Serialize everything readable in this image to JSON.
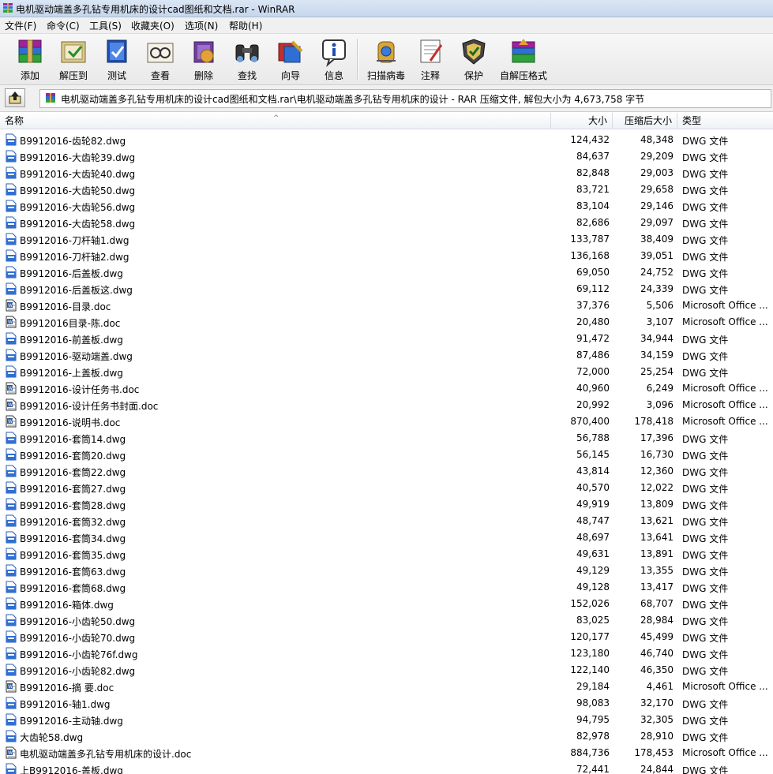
{
  "window": {
    "title": "电机驱动端盖多孔钻专用机床的设计cad图纸和文档.rar - WinRAR",
    "app_icon": "winrar-icon"
  },
  "menu": [
    {
      "label": "文件(F)"
    },
    {
      "label": "命令(C)"
    },
    {
      "label": "工具(S)"
    },
    {
      "label": "收藏夹(O)"
    },
    {
      "label": "选项(N)"
    },
    {
      "label": "帮助(H)"
    }
  ],
  "toolbar": [
    {
      "label": "添加",
      "icon": "add-archive-icon"
    },
    {
      "label": "解压到",
      "icon": "extract-to-icon"
    },
    {
      "label": "测试",
      "icon": "test-icon"
    },
    {
      "label": "查看",
      "icon": "view-icon"
    },
    {
      "label": "删除",
      "icon": "delete-icon"
    },
    {
      "label": "查找",
      "icon": "find-icon"
    },
    {
      "label": "向导",
      "icon": "wizard-icon"
    },
    {
      "label": "信息",
      "icon": "info-icon"
    },
    {
      "label": "扫描病毒",
      "icon": "virus-scan-icon"
    },
    {
      "label": "注释",
      "icon": "comment-icon"
    },
    {
      "label": "保护",
      "icon": "protect-icon"
    },
    {
      "label": "自解压格式",
      "icon": "sfx-icon"
    }
  ],
  "address": {
    "path": "电机驱动端盖多孔钻专用机床的设计cad图纸和文档.rar\\电机驱动端盖多孔钻专用机床的设计 - RAR 压缩文件, 解包大小为 4,673,758 字节"
  },
  "columns": {
    "name": "名称",
    "size": "大小",
    "packed": "压缩后大小",
    "type": "类型"
  },
  "files": [
    {
      "name": "B9912016-齿轮82.dwg",
      "size": "124,432",
      "packed": "48,348",
      "type": "DWG 文件",
      "icon": "dwg-file-icon"
    },
    {
      "name": "B9912016-大齿轮39.dwg",
      "size": "84,637",
      "packed": "29,209",
      "type": "DWG 文件",
      "icon": "dwg-file-icon"
    },
    {
      "name": "B9912016-大齿轮40.dwg",
      "size": "82,848",
      "packed": "29,003",
      "type": "DWG 文件",
      "icon": "dwg-file-icon"
    },
    {
      "name": "B9912016-大齿轮50.dwg",
      "size": "83,721",
      "packed": "29,658",
      "type": "DWG 文件",
      "icon": "dwg-file-icon"
    },
    {
      "name": "B9912016-大齿轮56.dwg",
      "size": "83,104",
      "packed": "29,146",
      "type": "DWG 文件",
      "icon": "dwg-file-icon"
    },
    {
      "name": "B9912016-大齿轮58.dwg",
      "size": "82,686",
      "packed": "29,097",
      "type": "DWG 文件",
      "icon": "dwg-file-icon"
    },
    {
      "name": "B9912016-刀杆轴1.dwg",
      "size": "133,787",
      "packed": "38,409",
      "type": "DWG 文件",
      "icon": "dwg-file-icon"
    },
    {
      "name": "B9912016-刀杆轴2.dwg",
      "size": "136,168",
      "packed": "39,051",
      "type": "DWG 文件",
      "icon": "dwg-file-icon"
    },
    {
      "name": "B9912016-后盖板.dwg",
      "size": "69,050",
      "packed": "24,752",
      "type": "DWG 文件",
      "icon": "dwg-file-icon"
    },
    {
      "name": "B9912016-后盖板这.dwg",
      "size": "69,112",
      "packed": "24,339",
      "type": "DWG 文件",
      "icon": "dwg-file-icon"
    },
    {
      "name": "B9912016-目录.doc",
      "size": "37,376",
      "packed": "5,506",
      "type": "Microsoft Office ...",
      "icon": "word-doc-icon"
    },
    {
      "name": "B9912016目录-陈.doc",
      "size": "20,480",
      "packed": "3,107",
      "type": "Microsoft Office ...",
      "icon": "word-doc-icon"
    },
    {
      "name": "B9912016-前盖板.dwg",
      "size": "91,472",
      "packed": "34,944",
      "type": "DWG 文件",
      "icon": "dwg-file-icon"
    },
    {
      "name": "B9912016-驱动端盖.dwg",
      "size": "87,486",
      "packed": "34,159",
      "type": "DWG 文件",
      "icon": "dwg-file-icon"
    },
    {
      "name": "B9912016-上盖板.dwg",
      "size": "72,000",
      "packed": "25,254",
      "type": "DWG 文件",
      "icon": "dwg-file-icon"
    },
    {
      "name": "B9912016-设计任务书.doc",
      "size": "40,960",
      "packed": "6,249",
      "type": "Microsoft Office ...",
      "icon": "word-doc-icon"
    },
    {
      "name": "B9912016-设计任务书封面.doc",
      "size": "20,992",
      "packed": "3,096",
      "type": "Microsoft Office ...",
      "icon": "word-doc-icon"
    },
    {
      "name": "B9912016-说明书.doc",
      "size": "870,400",
      "packed": "178,418",
      "type": "Microsoft Office ...",
      "icon": "word-doc-icon"
    },
    {
      "name": "B9912016-套筒14.dwg",
      "size": "56,788",
      "packed": "17,396",
      "type": "DWG 文件",
      "icon": "dwg-file-icon"
    },
    {
      "name": "B9912016-套筒20.dwg",
      "size": "56,145",
      "packed": "16,730",
      "type": "DWG 文件",
      "icon": "dwg-file-icon"
    },
    {
      "name": "B9912016-套筒22.dwg",
      "size": "43,814",
      "packed": "12,360",
      "type": "DWG 文件",
      "icon": "dwg-file-icon"
    },
    {
      "name": "B9912016-套筒27.dwg",
      "size": "40,570",
      "packed": "12,022",
      "type": "DWG 文件",
      "icon": "dwg-file-icon"
    },
    {
      "name": "B9912016-套筒28.dwg",
      "size": "49,919",
      "packed": "13,809",
      "type": "DWG 文件",
      "icon": "dwg-file-icon"
    },
    {
      "name": "B9912016-套筒32.dwg",
      "size": "48,747",
      "packed": "13,621",
      "type": "DWG 文件",
      "icon": "dwg-file-icon"
    },
    {
      "name": "B9912016-套筒34.dwg",
      "size": "48,697",
      "packed": "13,641",
      "type": "DWG 文件",
      "icon": "dwg-file-icon"
    },
    {
      "name": "B9912016-套筒35.dwg",
      "size": "49,631",
      "packed": "13,891",
      "type": "DWG 文件",
      "icon": "dwg-file-icon"
    },
    {
      "name": "B9912016-套筒63.dwg",
      "size": "49,129",
      "packed": "13,355",
      "type": "DWG 文件",
      "icon": "dwg-file-icon"
    },
    {
      "name": "B9912016-套筒68.dwg",
      "size": "49,128",
      "packed": "13,417",
      "type": "DWG 文件",
      "icon": "dwg-file-icon"
    },
    {
      "name": "B9912016-箱体.dwg",
      "size": "152,026",
      "packed": "68,707",
      "type": "DWG 文件",
      "icon": "dwg-file-icon"
    },
    {
      "name": "B9912016-小齿轮50.dwg",
      "size": "83,025",
      "packed": "28,984",
      "type": "DWG 文件",
      "icon": "dwg-file-icon"
    },
    {
      "name": "B9912016-小齿轮70.dwg",
      "size": "120,177",
      "packed": "45,499",
      "type": "DWG 文件",
      "icon": "dwg-file-icon"
    },
    {
      "name": "B9912016-小齿轮76f.dwg",
      "size": "123,180",
      "packed": "46,740",
      "type": "DWG 文件",
      "icon": "dwg-file-icon"
    },
    {
      "name": "B9912016-小齿轮82.dwg",
      "size": "122,140",
      "packed": "46,350",
      "type": "DWG 文件",
      "icon": "dwg-file-icon"
    },
    {
      "name": "B9912016-摘 要.doc",
      "size": "29,184",
      "packed": "4,461",
      "type": "Microsoft Office ...",
      "icon": "word-doc-icon"
    },
    {
      "name": "B9912016-轴1.dwg",
      "size": "98,083",
      "packed": "32,170",
      "type": "DWG 文件",
      "icon": "dwg-file-icon"
    },
    {
      "name": "B9912016-主动轴.dwg",
      "size": "94,795",
      "packed": "32,305",
      "type": "DWG 文件",
      "icon": "dwg-file-icon"
    },
    {
      "name": "大齿轮58.dwg",
      "size": "82,978",
      "packed": "28,910",
      "type": "DWG 文件",
      "icon": "dwg-file-icon"
    },
    {
      "name": "电机驱动端盖多孔钻专用机床的设计.doc",
      "size": "884,736",
      "packed": "178,453",
      "type": "Microsoft Office ...",
      "icon": "word-doc-icon"
    },
    {
      "name": "上B9912016-盖板.dwg",
      "size": "72,441",
      "packed": "24,844",
      "type": "DWG 文件",
      "icon": "dwg-file-icon"
    }
  ]
}
